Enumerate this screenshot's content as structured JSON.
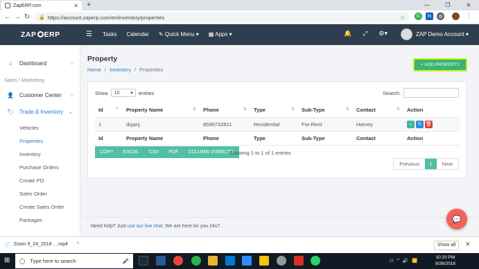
{
  "browser": {
    "tab_title": "ZapERP.com",
    "new_tab": "+",
    "url": "https://account.zaperp.com/en/inventory/properties"
  },
  "header": {
    "logo_left": "ZAP",
    "logo_right": "ERP",
    "nav": [
      "Tasks",
      "Calendar",
      "Quick Menu ▾",
      "Apps ▾"
    ],
    "account_label": "ZAP Demo Account ▾"
  },
  "sidebar": {
    "dashboard": "Dashboard",
    "section": "Sales / Marketing",
    "customer_center": "Customer Center",
    "trade_inventory": "Trade & Inventory",
    "subitems": [
      "Vehicles",
      "Properties",
      "Inventory",
      "Purchase Orders",
      "Create PO",
      "Sales Order",
      "Create Sales Order",
      "Packages"
    ]
  },
  "page": {
    "title": "Property",
    "breadcrumb": [
      "Home",
      "/",
      "Inventory",
      "/",
      "Properties"
    ],
    "add_button": "ADD PROPERTY",
    "add_button_icon": "+"
  },
  "table": {
    "show_label": "Show",
    "show_value": "10",
    "entries_label": "entries",
    "search_label": "Search:",
    "columns": [
      "Id",
      "Property Name",
      "Phone",
      "Type",
      "Sub-Type",
      "Contact",
      "Action"
    ],
    "rows": [
      {
        "id": "1",
        "name": "dsjanj",
        "phone": "8595732821",
        "type": "Residential",
        "subtype": "For-Rent",
        "contact": "Harvey"
      }
    ],
    "export_buttons": [
      "COPY",
      "EXCEL",
      "CSV",
      "PDF",
      "COLUMN VISIBILITY"
    ],
    "showing_text": "Showing 1 to 1 of 1 entries",
    "pager": {
      "previous": "Previous",
      "current": "1",
      "next": "Next"
    }
  },
  "footer": {
    "text_before": "Need help? Just",
    "link": "use our live chat.",
    "text_after": "We are here for you 24x7."
  },
  "downloads": {
    "file": "Zoom 9_24_2018 ....mp4",
    "show_all": "Show all"
  },
  "taskbar": {
    "search_placeholder": "Type here to search",
    "time": "10:20 PM",
    "date": "9/26/2018"
  },
  "colors": {
    "header_bg": "#2f3e4e",
    "accent_green": "#50bfa5",
    "add_button": "#3cb371",
    "highlight": "#c8ef1f",
    "link_blue": "#2f7ac4",
    "chat_button": "#f2635a"
  }
}
